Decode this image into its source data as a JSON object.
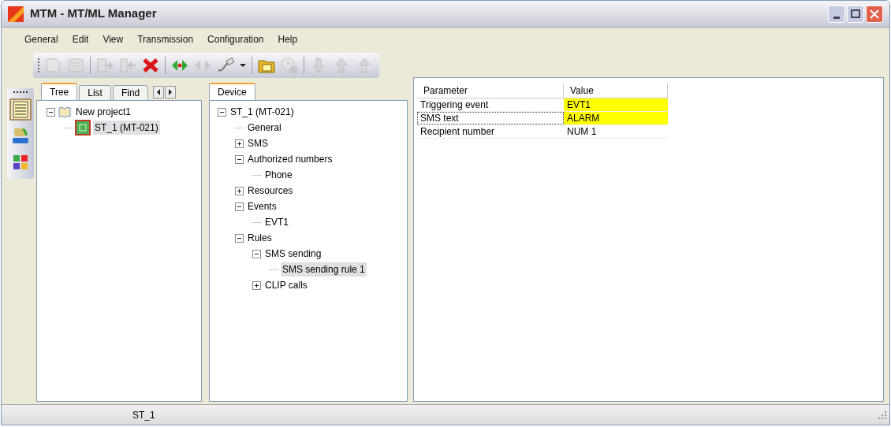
{
  "window": {
    "title": "MTM - MT/ML Manager"
  },
  "menu": [
    "General",
    "Edit",
    "View",
    "Transmission",
    "Configuration",
    "Help"
  ],
  "toolbar": [
    {
      "kind": "new",
      "disabled": true
    },
    {
      "kind": "save",
      "disabled": true
    },
    {
      "kind": "sep"
    },
    {
      "kind": "import",
      "disabled": true
    },
    {
      "kind": "export",
      "disabled": true
    },
    {
      "kind": "delete",
      "disabled": false
    },
    {
      "kind": "sep"
    },
    {
      "kind": "connect",
      "disabled": false
    },
    {
      "kind": "disconnect",
      "disabled": true
    },
    {
      "kind": "cable",
      "disabled": false
    },
    {
      "kind": "dropdown",
      "disabled": false
    },
    {
      "kind": "sep"
    },
    {
      "kind": "folder",
      "disabled": false
    },
    {
      "kind": "clock",
      "disabled": true
    },
    {
      "kind": "sep"
    },
    {
      "kind": "down",
      "disabled": true
    },
    {
      "kind": "up",
      "disabled": true
    },
    {
      "kind": "up2",
      "disabled": true
    }
  ],
  "rail": [
    {
      "kind": "tree",
      "selected": true
    },
    {
      "kind": "arc",
      "selected": false
    },
    {
      "kind": "blocks",
      "selected": false
    }
  ],
  "left_tabs": [
    {
      "label": "Tree",
      "selected": true
    },
    {
      "label": "List",
      "selected": false
    },
    {
      "label": "Find",
      "selected": false
    }
  ],
  "left_tree": [
    {
      "label": "New project1",
      "kind": "book",
      "expanded": true,
      "selected": false,
      "children": [
        {
          "label": "ST_1 (MT-021)",
          "kind": "device",
          "selected": true
        }
      ]
    }
  ],
  "device_tab": {
    "label": "Device",
    "selected": true
  },
  "device_tree": [
    {
      "label": "ST_1 (MT-021)",
      "expanded": true,
      "selected": false,
      "children": [
        {
          "label": "General",
          "selected": false
        },
        {
          "label": "SMS",
          "expanded": false,
          "selected": false
        },
        {
          "label": "Authorized numbers",
          "expanded": true,
          "selected": false,
          "children": [
            {
              "label": "Phone",
              "selected": false
            }
          ]
        },
        {
          "label": "Resources",
          "expanded": false,
          "selected": false
        },
        {
          "label": "Events",
          "expanded": true,
          "selected": false,
          "children": [
            {
              "label": "EVT1",
              "selected": false
            }
          ]
        },
        {
          "label": "Rules",
          "expanded": true,
          "selected": false,
          "children": [
            {
              "label": "SMS sending",
              "expanded": true,
              "selected": false,
              "children": [
                {
                  "label": "SMS sending rule 1",
                  "selected": true
                }
              ]
            },
            {
              "label": "CLIP calls",
              "expanded": false,
              "selected": false
            }
          ]
        }
      ]
    }
  ],
  "table": {
    "columns": [
      "Parameter",
      "Value"
    ],
    "rows": [
      {
        "parameter": "Triggering event",
        "value": "EVT1",
        "highlighted": true,
        "focused": false
      },
      {
        "parameter": "SMS text",
        "value": "ALARM",
        "highlighted": true,
        "focused": true
      },
      {
        "parameter": "Recipient number",
        "value": "NUM 1",
        "highlighted": false,
        "focused": false
      }
    ]
  },
  "status_bar": {
    "text": "ST_1"
  }
}
